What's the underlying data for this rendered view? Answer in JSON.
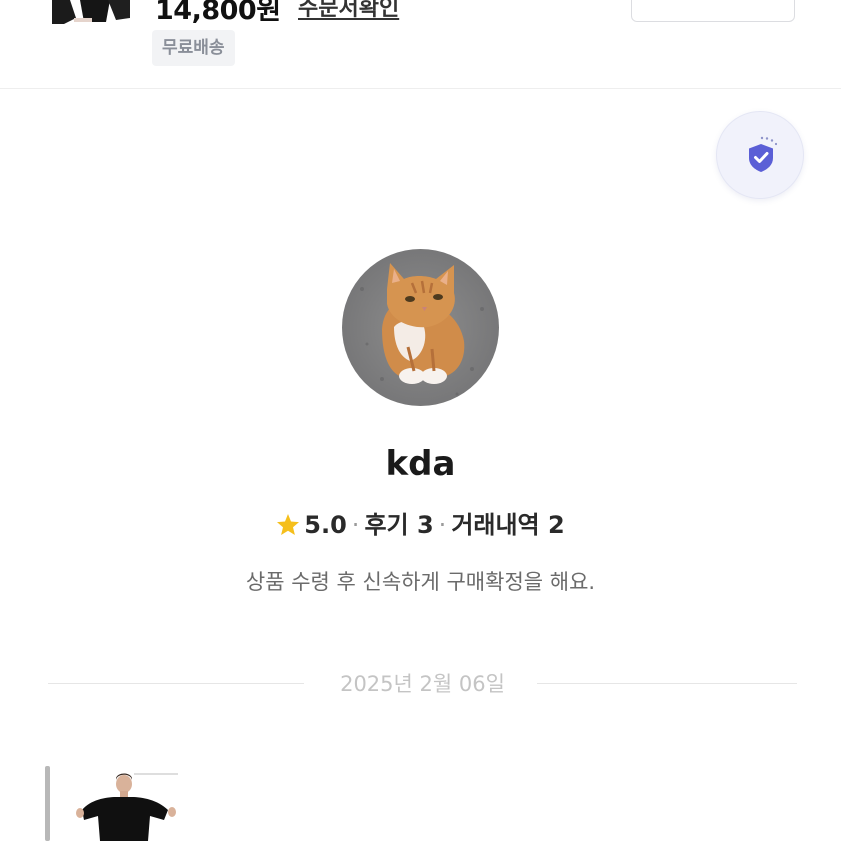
{
  "product": {
    "price": "14,800원",
    "order_link": "주문서확인",
    "shipping_badge": "무료배송",
    "thumbnail_icon": "product-thumbnail-icon"
  },
  "safety": {
    "icon": "shield-check-icon",
    "accent": "#5b5fd6"
  },
  "profile": {
    "avatar_icon": "cat-avatar",
    "username": "kda",
    "rating_icon": "star-icon",
    "rating": "5.0",
    "reviews_label": "후기",
    "reviews_count": "3",
    "transactions_label": "거래내역",
    "transactions_count": "2",
    "separator": "·",
    "tagline": "상품 수령 후 신속하게 구매확정을 해요."
  },
  "chat": {
    "date_divider": "2025년 2월 06일",
    "message_image_icon": "product-photo-icon"
  },
  "colors": {
    "star": "#f5bf1c",
    "muted_text": "#6b6b6b",
    "divider_text": "#c4c4c4"
  }
}
